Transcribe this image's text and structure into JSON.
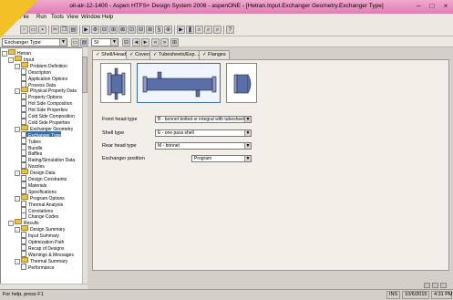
{
  "window": {
    "title": "oil-air-12-1400 - Aspen HTFS+ Design System 2006 - aspenONE - [Hetran.Input.Exchanger Geometry.Exchanger Type]",
    "controls": [
      "–",
      "□",
      "×"
    ]
  },
  "menu": [
    "File",
    "Run",
    "Tools",
    "View",
    "Window",
    "Help"
  ],
  "toolbar": {
    "object_select": "Exchanger Type",
    "units_select": "SI",
    "nav": [
      "◄",
      "►",
      "«",
      "»",
      "⊞"
    ]
  },
  "tree": {
    "items": [
      {
        "label": "Hetran",
        "level": 0,
        "type": "folder",
        "exp": "-"
      },
      {
        "label": "Input",
        "level": 1,
        "type": "folder",
        "exp": "-"
      },
      {
        "label": "Problem Definition",
        "level": 2,
        "type": "folder",
        "exp": "-"
      },
      {
        "label": "Description",
        "level": 3,
        "type": "page"
      },
      {
        "label": "Application Options",
        "level": 3,
        "type": "page"
      },
      {
        "label": "Process Data",
        "level": 3,
        "type": "page"
      },
      {
        "label": "Physical Property Data",
        "level": 2,
        "type": "folder",
        "exp": "-"
      },
      {
        "label": "Property Options",
        "level": 3,
        "type": "page"
      },
      {
        "label": "Hot Side Composition",
        "level": 3,
        "type": "page"
      },
      {
        "label": "Hot Side Properties",
        "level": 3,
        "type": "page"
      },
      {
        "label": "Cold Side Composition",
        "level": 3,
        "type": "page"
      },
      {
        "label": "Cold Side Properties",
        "level": 3,
        "type": "page"
      },
      {
        "label": "Exchanger Geometry",
        "level": 2,
        "type": "folder",
        "exp": "-"
      },
      {
        "label": "Exchanger Type",
        "level": 3,
        "type": "page",
        "selected": true
      },
      {
        "label": "Tubes",
        "level": 3,
        "type": "page"
      },
      {
        "label": "Bundle",
        "level": 3,
        "type": "page"
      },
      {
        "label": "Baffles",
        "level": 3,
        "type": "page"
      },
      {
        "label": "Rating/Simulation Data",
        "level": 3,
        "type": "page"
      },
      {
        "label": "Nozzles",
        "level": 3,
        "type": "page"
      },
      {
        "label": "Design Data",
        "level": 2,
        "type": "folder",
        "exp": "-"
      },
      {
        "label": "Design Constraints",
        "level": 3,
        "type": "page"
      },
      {
        "label": "Materials",
        "level": 3,
        "type": "page"
      },
      {
        "label": "Specifications",
        "level": 3,
        "type": "page"
      },
      {
        "label": "Program Options",
        "level": 2,
        "type": "folder",
        "exp": "-"
      },
      {
        "label": "Thermal Analysis",
        "level": 3,
        "type": "page"
      },
      {
        "label": "Correlations",
        "level": 3,
        "type": "page"
      },
      {
        "label": "Change Codes",
        "level": 3,
        "type": "page"
      },
      {
        "label": "Results",
        "level": 1,
        "type": "folder",
        "exp": "-"
      },
      {
        "label": "Design Summary",
        "level": 2,
        "type": "folder",
        "exp": "-"
      },
      {
        "label": "Input Summary",
        "level": 3,
        "type": "page"
      },
      {
        "label": "Optimization Path",
        "level": 3,
        "type": "page"
      },
      {
        "label": "Recap of Designs",
        "level": 3,
        "type": "page"
      },
      {
        "label": "Warnings & Messages",
        "level": 3,
        "type": "page"
      },
      {
        "label": "Thermal Summary",
        "level": 2,
        "type": "folder",
        "exp": "-"
      },
      {
        "label": "Performance",
        "level": 3,
        "type": "page"
      }
    ]
  },
  "tabs": [
    "✓ Shell/Heads",
    "✓ Covers",
    "✓ Tubesheets/Exp. Jnts.",
    "✓ Flanges"
  ],
  "form": {
    "front_head": {
      "label": "Front head type",
      "value": "B - bonnet bolted or integral with tubesheet"
    },
    "shell": {
      "label": "Shell type",
      "value": "E - one pass shell"
    },
    "rear_head": {
      "label": "Rear head type",
      "value": "M - bonnet"
    },
    "position": {
      "label": "Exchanger position",
      "value": "Program"
    }
  },
  "status": {
    "help": "For help, press F1",
    "ins": "INS",
    "date": "10/6/2015",
    "time": "4:31 PM"
  },
  "colors": {
    "titlebar": "#e07db4",
    "selection": "#3a6ea5",
    "accent": "#f4c028"
  }
}
